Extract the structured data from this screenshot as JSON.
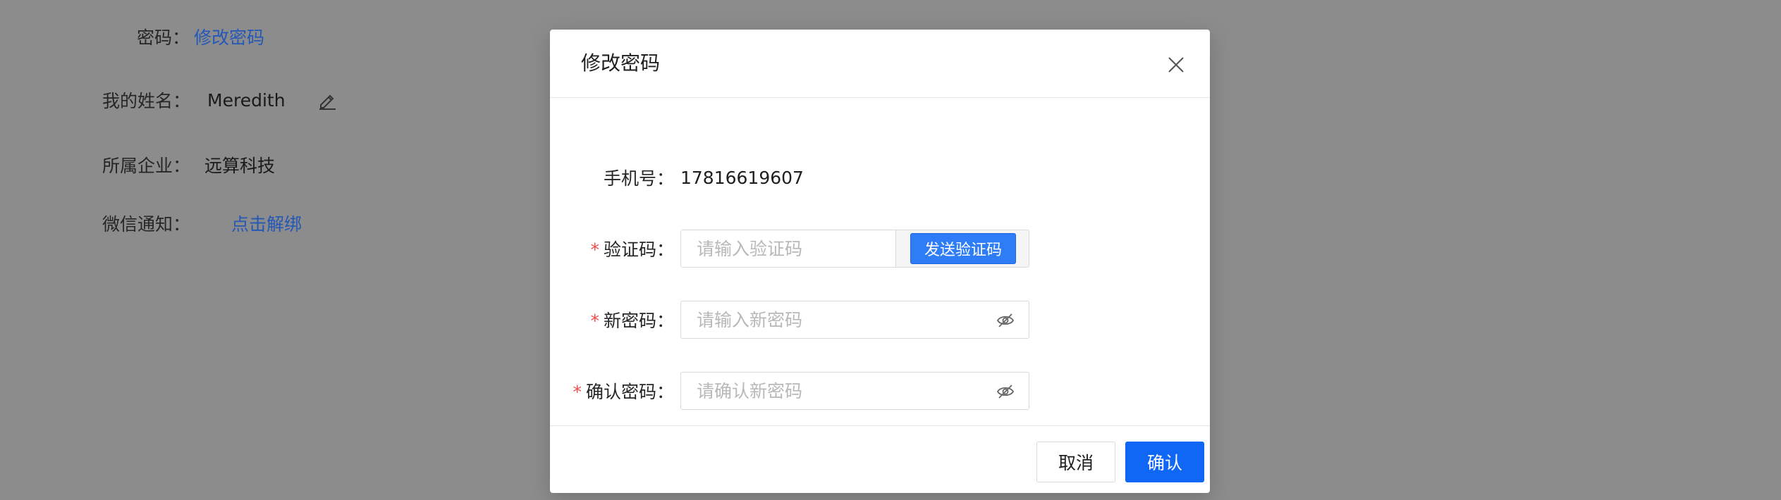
{
  "profile": {
    "password_label": "密码：",
    "password_link": "修改密码",
    "name_label": "我的姓名：",
    "name_value": "Meredith",
    "company_label": "所属企业：",
    "company_value": "远算科技",
    "wechat_label": "微信通知：",
    "wechat_link": "点击解绑"
  },
  "modal": {
    "title": "修改密码",
    "phone_label": "手机号：",
    "phone_value": "17816619607",
    "required_mark": "*",
    "code_label": "验证码：",
    "code_placeholder": "请输入验证码",
    "send_code_label": "发送验证码",
    "new_password_label": "新密码：",
    "new_password_placeholder": "请输入新密码",
    "confirm_password_label": "确认密码：",
    "confirm_password_placeholder": "请确认新密码",
    "cancel_label": "取消",
    "ok_label": "确认"
  },
  "icons": {
    "edit": "pencil-icon",
    "close": "close-icon",
    "eye": "eye-slash-icon"
  },
  "colors": {
    "primary": "#1066f5",
    "send_button": "#2f7df6",
    "link": "#2458b8",
    "required": "#f24b4b",
    "overlay": "#8c8c8c"
  }
}
